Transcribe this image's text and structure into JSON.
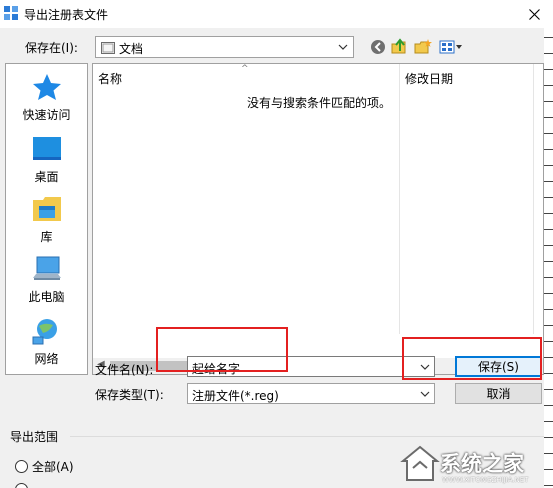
{
  "window": {
    "title": "导出注册表文件",
    "close_glyph": "✕"
  },
  "savein": {
    "label": "保存在(I):",
    "value": "文档",
    "dropdown_glyph": "⌵"
  },
  "places": [
    {
      "label": "快速访问",
      "icon": "star-icon"
    },
    {
      "label": "桌面",
      "icon": "desktop-icon"
    },
    {
      "label": "库",
      "icon": "library-icon"
    },
    {
      "label": "此电脑",
      "icon": "computer-icon"
    },
    {
      "label": "网络",
      "icon": "network-icon"
    }
  ],
  "filelist": {
    "columns": [
      "名称",
      "修改日期"
    ],
    "empty_message": "没有与搜索条件匹配的项。"
  },
  "filename": {
    "label": "文件名(N):",
    "value": "起给名字"
  },
  "filetype": {
    "label": "保存类型(T):",
    "value": "注册文件(*.reg)"
  },
  "buttons": {
    "save": "保存(S)",
    "cancel": "取消"
  },
  "export_range": {
    "title": "导出范围",
    "all_option": "全部(A)"
  },
  "watermark": {
    "text": "系统之家",
    "url": "WWW.XITONGZHIJIA.NET"
  },
  "colors": {
    "annotation_red": "#e32020",
    "accent_blue": "#0078d7"
  }
}
